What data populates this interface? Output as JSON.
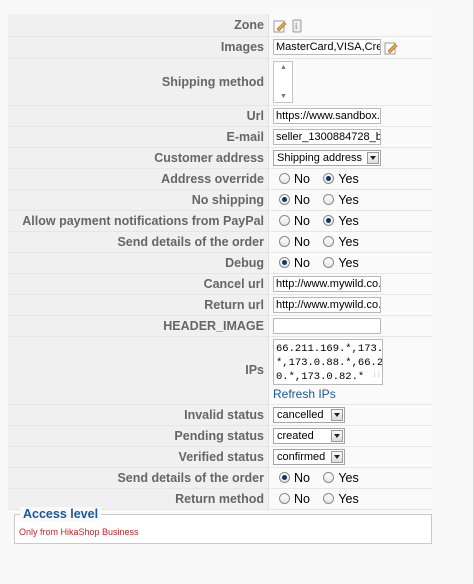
{
  "fields": {
    "zone": {
      "label": "Zone"
    },
    "images": {
      "label": "Images",
      "value": "MasterCard,VISA,Cred"
    },
    "shipping_method": {
      "label": "Shipping method"
    },
    "url": {
      "label": "Url",
      "value": "https://www.sandbox.p"
    },
    "email": {
      "label": "E-mail",
      "value": "seller_1300884728_b"
    },
    "customer_address": {
      "label": "Customer address",
      "value": "Shipping address"
    },
    "address_override": {
      "label": "Address override",
      "selected": "Yes"
    },
    "no_shipping": {
      "label": "No shipping",
      "selected": "No"
    },
    "allow_notifications": {
      "label": "Allow payment notifications from PayPal",
      "selected": "Yes"
    },
    "send_details_1": {
      "label": "Send details of the order",
      "selected": "none"
    },
    "debug": {
      "label": "Debug",
      "selected": "No"
    },
    "cancel_url": {
      "label": "Cancel url",
      "value": "http://www.mywild.co.u"
    },
    "return_url": {
      "label": "Return url",
      "value": "http://www.mywild.co.u"
    },
    "header_image": {
      "label": "HEADER_IMAGE",
      "value": ""
    },
    "ips": {
      "label": "IPs",
      "value": "66.211.169.*,173.0.84.\n*,173.0.88.*,66.211.17\n0.*,173.0.82.*",
      "refresh_label": "Refresh IPs"
    },
    "invalid_status": {
      "label": "Invalid status",
      "value": "cancelled"
    },
    "pending_status": {
      "label": "Pending status",
      "value": "created"
    },
    "verified_status": {
      "label": "Verified status",
      "value": "confirmed"
    },
    "send_details_2": {
      "label": "Send details of the order",
      "selected": "No"
    },
    "return_method": {
      "label": "Return method",
      "selected": "none"
    }
  },
  "radio_labels": {
    "no": "No",
    "yes": "Yes"
  },
  "access": {
    "legend": "Access level",
    "note": "Only from HikaShop Business"
  },
  "colors": {
    "link": "#1a56a0",
    "note": "#cc1f1f",
    "label": "#666666"
  }
}
